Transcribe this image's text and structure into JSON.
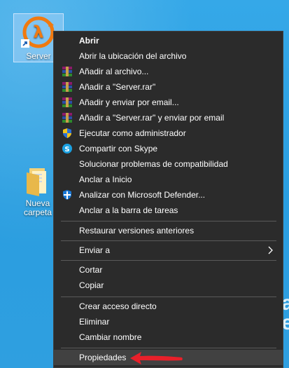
{
  "desktop": {
    "icons": [
      {
        "label": "Server",
        "icon": "half-life-lambda-icon"
      },
      {
        "label": "Nueva carpeta",
        "icon": "folder-icon"
      }
    ],
    "background_color": "#2c9fe0"
  },
  "context_menu": {
    "items": [
      {
        "label": "Abrir",
        "icon": "",
        "bold": true
      },
      {
        "label": "Abrir la ubicación del archivo",
        "icon": ""
      },
      {
        "label": "Añadir al archivo...",
        "icon": "winrar-icon"
      },
      {
        "label": "Añadir a \"Server.rar\"",
        "icon": "winrar-icon"
      },
      {
        "label": "Añadir y enviar por email...",
        "icon": "winrar-icon"
      },
      {
        "label": "Añadir a \"Server.rar\" y enviar por email",
        "icon": "winrar-icon"
      },
      {
        "label": "Ejecutar como administrador",
        "icon": "uac-shield-icon"
      },
      {
        "label": "Compartir con Skype",
        "icon": "skype-icon"
      },
      {
        "label": "Solucionar problemas de compatibilidad",
        "icon": ""
      },
      {
        "label": "Anclar a Inicio",
        "icon": ""
      },
      {
        "label": "Analizar con Microsoft Defender...",
        "icon": "defender-icon"
      },
      {
        "label": "Anclar a la barra de tareas",
        "icon": ""
      },
      {
        "label": "Restaurar versiones anteriores",
        "icon": ""
      },
      {
        "label": "Enviar a",
        "icon": "",
        "submenu": true
      },
      {
        "label": "Cortar",
        "icon": ""
      },
      {
        "label": "Copiar",
        "icon": ""
      },
      {
        "label": "Crear acceso directo",
        "icon": ""
      },
      {
        "label": "Eliminar",
        "icon": ""
      },
      {
        "label": "Cambiar nombre",
        "icon": ""
      },
      {
        "label": "Propiedades",
        "icon": "",
        "highlighted": true
      }
    ],
    "background_color": "#2b2b2b",
    "highlight_color": "#414141"
  },
  "annotation": {
    "icon": "red-arrow-icon",
    "color": "#e8202a"
  }
}
